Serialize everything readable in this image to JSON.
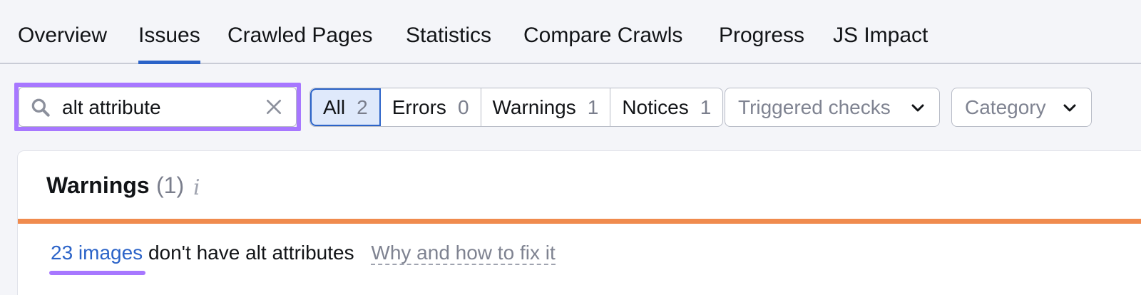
{
  "tabs": {
    "overview": "Overview",
    "issues": "Issues",
    "crawled_pages": "Crawled Pages",
    "statistics": "Statistics",
    "compare_crawls": "Compare Crawls",
    "progress": "Progress",
    "js_impact": "JS Impact",
    "active": "Issues"
  },
  "search": {
    "value": "alt attribute",
    "search_icon": "search-icon",
    "clear_icon": "close-icon"
  },
  "filters": {
    "all_label": "All",
    "all_count": "2",
    "errors_label": "Errors",
    "errors_count": "0",
    "warnings_label": "Warnings",
    "warnings_count": "1",
    "notices_label": "Notices",
    "notices_count": "1"
  },
  "dropdowns": {
    "triggered_checks": "Triggered checks",
    "category": "Category"
  },
  "panel": {
    "title": "Warnings",
    "count": "(1)",
    "info": "i",
    "accent_color": "#f08b4e",
    "issue_link": "23 images",
    "issue_text": "don't have alt attributes",
    "fix_link": "Why and how to fix it"
  },
  "colors": {
    "highlight": "#a777ff",
    "link": "#2b63c8"
  }
}
